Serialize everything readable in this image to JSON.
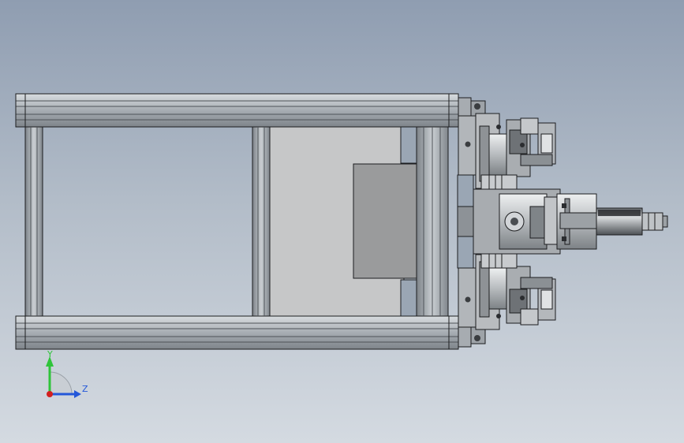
{
  "viewport": {
    "background_top": "#8f9db1",
    "background_bottom": "#d4dae1"
  },
  "colors": {
    "frame_metal": "#aeb4ba",
    "frame_dark": "#5a5e63",
    "plate_light": "#c6c7c8",
    "block_gray": "#9a9b9c",
    "outline": "#1c1d1f",
    "mechanism": "#b9bcbf",
    "mechanism_dark": "#6e7276"
  },
  "triad": {
    "y_label": "Y",
    "z_label": "Z",
    "y_color": "#2fc43a",
    "z_color": "#2457d9",
    "x_color": "#d21f1f"
  }
}
